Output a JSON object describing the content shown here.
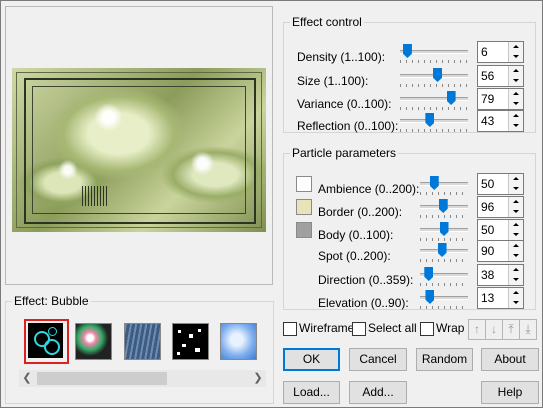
{
  "effect_control": {
    "title": "Effect control",
    "sliders": [
      {
        "label_u": "D",
        "label_rest": "ensity (1..100):",
        "value": "6",
        "level": 0.05
      },
      {
        "label_u": "",
        "label_rest": "Size (1..100):",
        "value": "56",
        "level": 0.56
      },
      {
        "label_u": "V",
        "label_rest": "ariance (0..100):",
        "value": "79",
        "level": 0.79
      },
      {
        "label_u": "",
        "label_rest": "Reflection (0..100):",
        "value": "43",
        "level": 0.43
      }
    ]
  },
  "particle_parameters": {
    "title": "Particle parameters",
    "rows": [
      {
        "label_u": "",
        "label_pre": "Ambie",
        "label_mid": "n",
        "label_rest": "ce (0..200):",
        "value": "50",
        "level": 0.25,
        "swatch": "#ffffff"
      },
      {
        "label_u": "B",
        "label_rest": "order (0..200):",
        "value": "96",
        "level": 0.48,
        "swatch": "#e9e3b8"
      },
      {
        "label_u": "B",
        "label_rest": "ody (0..100):",
        "value": "50",
        "level": 0.5,
        "swatch": "#a0a0a0"
      },
      {
        "label_u": "",
        "label_rest": "Spot (0..200):",
        "value": "90",
        "level": 0.45
      },
      {
        "label_u": "",
        "label_rest": "Direction (0..359):",
        "value": "38",
        "level": 0.11
      },
      {
        "label_u": "E",
        "label_rest": "levation (0..90):",
        "value": "13",
        "level": 0.14
      }
    ]
  },
  "effects": {
    "title": "Effect: Bubble",
    "items": [
      "bubble",
      "glow",
      "rain",
      "stars",
      "sky"
    ]
  },
  "options": {
    "wireframe": "Wireframe",
    "select_all": "Select all",
    "wrap": "Wrap"
  },
  "buttons": {
    "ok": "OK",
    "cancel": "Cancel",
    "random": "Random",
    "about": "About",
    "load": "Load...",
    "add": "Add...",
    "help": "Help"
  },
  "colors": {
    "accent": "#0078d7",
    "selected_border": "#dd2222"
  }
}
